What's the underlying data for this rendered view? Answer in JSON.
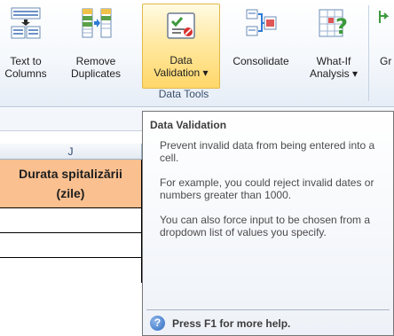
{
  "ribbon": {
    "buttons": [
      {
        "line1": "Text to",
        "line2": "Columns"
      },
      {
        "line1": "Remove",
        "line2": "Duplicates"
      },
      {
        "line1": "Data",
        "line2": "Validation ▾"
      },
      {
        "line1": "Consolidate",
        "line2": ""
      },
      {
        "line1": "What-If",
        "line2": "Analysis ▾"
      },
      {
        "line1": "Gr",
        "line2": ""
      }
    ],
    "group_label": "Data Tools"
  },
  "sheet": {
    "column_letter": "J",
    "header_line1": "Durata spitalizării",
    "header_line2": "(zile)"
  },
  "tooltip": {
    "title": "Data Validation",
    "para1": "Prevent invalid data from being entered into a cell.",
    "para2": "For example, you could reject invalid dates or numbers greater than 1000.",
    "para3": "You can also force input to be chosen from a dropdown list of values you specify.",
    "help": "Press F1 for more help."
  },
  "colors": {
    "header_fill": "#fac090",
    "selected_button": "#ffd76a",
    "ribbon_text": "#1e1e1e"
  }
}
